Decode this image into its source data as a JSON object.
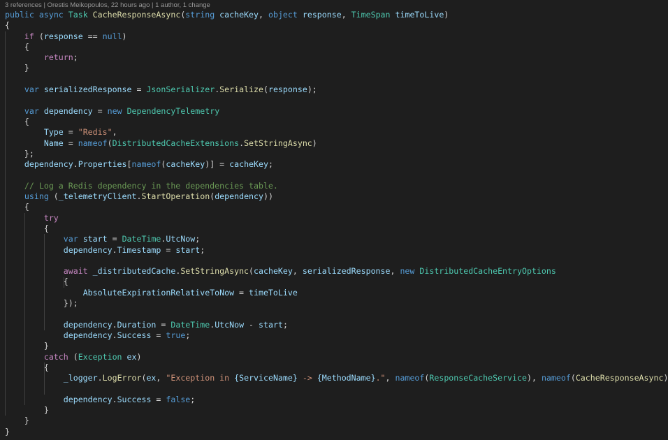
{
  "codelens": {
    "references": "3 references",
    "author": "Orestis Meikopoulos, 22 hours ago",
    "changes": "1 author, 1 change",
    "separator": " | "
  },
  "theme": {
    "background": "#1e1e1e",
    "keyword": "#569cd6",
    "control": "#c586c0",
    "type": "#4ec9b0",
    "method": "#dcdcaa",
    "identifier": "#9cdcfe",
    "string": "#ce9178",
    "comment": "#6a9955",
    "text": "#d4d4d4"
  },
  "code_lines": [
    {
      "spans": [
        {
          "c": "kw",
          "t": "public"
        },
        {
          "c": "tx",
          "t": " "
        },
        {
          "c": "kw",
          "t": "async"
        },
        {
          "c": "tx",
          "t": " "
        },
        {
          "c": "ty",
          "t": "Task"
        },
        {
          "c": "tx",
          "t": " "
        },
        {
          "c": "fn",
          "t": "CacheResponseAsync"
        },
        {
          "c": "tx",
          "t": "("
        },
        {
          "c": "kw",
          "t": "string"
        },
        {
          "c": "tx",
          "t": " "
        },
        {
          "c": "id",
          "t": "cacheKey"
        },
        {
          "c": "tx",
          "t": ", "
        },
        {
          "c": "kw",
          "t": "object"
        },
        {
          "c": "tx",
          "t": " "
        },
        {
          "c": "id",
          "t": "response"
        },
        {
          "c": "tx",
          "t": ", "
        },
        {
          "c": "ty",
          "t": "TimeSpan"
        },
        {
          "c": "tx",
          "t": " "
        },
        {
          "c": "id",
          "t": "timeToLive"
        },
        {
          "c": "tx",
          "t": ")"
        }
      ]
    },
    {
      "spans": [
        {
          "c": "tx",
          "t": "{"
        }
      ]
    },
    {
      "spans": [
        {
          "c": "tx",
          "t": "    "
        },
        {
          "c": "ctl",
          "t": "if"
        },
        {
          "c": "tx",
          "t": " ("
        },
        {
          "c": "id",
          "t": "response"
        },
        {
          "c": "tx",
          "t": " == "
        },
        {
          "c": "kw",
          "t": "null"
        },
        {
          "c": "tx",
          "t": ")"
        }
      ]
    },
    {
      "spans": [
        {
          "c": "tx",
          "t": "    {"
        }
      ]
    },
    {
      "spans": [
        {
          "c": "tx",
          "t": "        "
        },
        {
          "c": "ctl",
          "t": "return"
        },
        {
          "c": "tx",
          "t": ";"
        }
      ]
    },
    {
      "spans": [
        {
          "c": "tx",
          "t": "    }"
        }
      ]
    },
    {
      "spans": []
    },
    {
      "spans": [
        {
          "c": "tx",
          "t": "    "
        },
        {
          "c": "kw",
          "t": "var"
        },
        {
          "c": "tx",
          "t": " "
        },
        {
          "c": "id",
          "t": "serializedResponse"
        },
        {
          "c": "tx",
          "t": " = "
        },
        {
          "c": "ty",
          "t": "JsonSerializer"
        },
        {
          "c": "tx",
          "t": "."
        },
        {
          "c": "fn",
          "t": "Serialize"
        },
        {
          "c": "tx",
          "t": "("
        },
        {
          "c": "id",
          "t": "response"
        },
        {
          "c": "tx",
          "t": ");"
        }
      ]
    },
    {
      "spans": []
    },
    {
      "spans": [
        {
          "c": "tx",
          "t": "    "
        },
        {
          "c": "kw",
          "t": "var"
        },
        {
          "c": "tx",
          "t": " "
        },
        {
          "c": "id",
          "t": "dependency"
        },
        {
          "c": "tx",
          "t": " = "
        },
        {
          "c": "kw",
          "t": "new"
        },
        {
          "c": "tx",
          "t": " "
        },
        {
          "c": "ty",
          "t": "DependencyTelemetry"
        }
      ]
    },
    {
      "spans": [
        {
          "c": "tx",
          "t": "    {"
        }
      ]
    },
    {
      "spans": [
        {
          "c": "tx",
          "t": "        "
        },
        {
          "c": "id",
          "t": "Type"
        },
        {
          "c": "tx",
          "t": " = "
        },
        {
          "c": "str",
          "t": "\"Redis\""
        },
        {
          "c": "tx",
          "t": ","
        }
      ]
    },
    {
      "spans": [
        {
          "c": "tx",
          "t": "        "
        },
        {
          "c": "id",
          "t": "Name"
        },
        {
          "c": "tx",
          "t": " = "
        },
        {
          "c": "kw",
          "t": "nameof"
        },
        {
          "c": "tx",
          "t": "("
        },
        {
          "c": "ty",
          "t": "DistributedCacheExtensions"
        },
        {
          "c": "tx",
          "t": "."
        },
        {
          "c": "fn",
          "t": "SetStringAsync"
        },
        {
          "c": "tx",
          "t": ")"
        }
      ]
    },
    {
      "spans": [
        {
          "c": "tx",
          "t": "    };"
        }
      ]
    },
    {
      "spans": [
        {
          "c": "tx",
          "t": "    "
        },
        {
          "c": "id",
          "t": "dependency"
        },
        {
          "c": "tx",
          "t": "."
        },
        {
          "c": "id",
          "t": "Properties"
        },
        {
          "c": "tx",
          "t": "["
        },
        {
          "c": "kw",
          "t": "nameof"
        },
        {
          "c": "tx",
          "t": "("
        },
        {
          "c": "id",
          "t": "cacheKey"
        },
        {
          "c": "tx",
          "t": ")] = "
        },
        {
          "c": "id",
          "t": "cacheKey"
        },
        {
          "c": "tx",
          "t": ";"
        }
      ]
    },
    {
      "spans": []
    },
    {
      "spans": [
        {
          "c": "tx",
          "t": "    "
        },
        {
          "c": "cmt",
          "t": "// Log a Redis dependency in the dependencies table."
        }
      ]
    },
    {
      "spans": [
        {
          "c": "tx",
          "t": "    "
        },
        {
          "c": "kw",
          "t": "using"
        },
        {
          "c": "tx",
          "t": " ("
        },
        {
          "c": "id",
          "t": "_telemetryClient"
        },
        {
          "c": "tx",
          "t": "."
        },
        {
          "c": "fn",
          "t": "StartOperation"
        },
        {
          "c": "tx",
          "t": "("
        },
        {
          "c": "id",
          "t": "dependency"
        },
        {
          "c": "tx",
          "t": "))"
        }
      ]
    },
    {
      "spans": [
        {
          "c": "tx",
          "t": "    {"
        }
      ]
    },
    {
      "spans": [
        {
          "c": "tx",
          "t": "        "
        },
        {
          "c": "ctl",
          "t": "try"
        }
      ]
    },
    {
      "spans": [
        {
          "c": "tx",
          "t": "        {"
        }
      ]
    },
    {
      "spans": [
        {
          "c": "tx",
          "t": "            "
        },
        {
          "c": "kw",
          "t": "var"
        },
        {
          "c": "tx",
          "t": " "
        },
        {
          "c": "id",
          "t": "start"
        },
        {
          "c": "tx",
          "t": " = "
        },
        {
          "c": "ty",
          "t": "DateTime"
        },
        {
          "c": "tx",
          "t": "."
        },
        {
          "c": "id",
          "t": "UtcNow"
        },
        {
          "c": "tx",
          "t": ";"
        }
      ]
    },
    {
      "spans": [
        {
          "c": "tx",
          "t": "            "
        },
        {
          "c": "id",
          "t": "dependency"
        },
        {
          "c": "tx",
          "t": "."
        },
        {
          "c": "id",
          "t": "Timestamp"
        },
        {
          "c": "tx",
          "t": " = "
        },
        {
          "c": "id",
          "t": "start"
        },
        {
          "c": "tx",
          "t": ";"
        }
      ]
    },
    {
      "spans": []
    },
    {
      "spans": [
        {
          "c": "tx",
          "t": "            "
        },
        {
          "c": "ctl",
          "t": "await"
        },
        {
          "c": "tx",
          "t": " "
        },
        {
          "c": "id",
          "t": "_distributedCache"
        },
        {
          "c": "tx",
          "t": "."
        },
        {
          "c": "fn",
          "t": "SetStringAsync"
        },
        {
          "c": "tx",
          "t": "("
        },
        {
          "c": "id",
          "t": "cacheKey"
        },
        {
          "c": "tx",
          "t": ", "
        },
        {
          "c": "id",
          "t": "serializedResponse"
        },
        {
          "c": "tx",
          "t": ", "
        },
        {
          "c": "kw",
          "t": "new"
        },
        {
          "c": "tx",
          "t": " "
        },
        {
          "c": "ty",
          "t": "DistributedCacheEntryOptions"
        }
      ]
    },
    {
      "spans": [
        {
          "c": "tx",
          "t": "            {"
        }
      ]
    },
    {
      "spans": [
        {
          "c": "tx",
          "t": "                "
        },
        {
          "c": "id",
          "t": "AbsoluteExpirationRelativeToNow"
        },
        {
          "c": "tx",
          "t": " = "
        },
        {
          "c": "id",
          "t": "timeToLive"
        }
      ]
    },
    {
      "spans": [
        {
          "c": "tx",
          "t": "            });"
        }
      ]
    },
    {
      "spans": []
    },
    {
      "spans": [
        {
          "c": "tx",
          "t": "            "
        },
        {
          "c": "id",
          "t": "dependency"
        },
        {
          "c": "tx",
          "t": "."
        },
        {
          "c": "id",
          "t": "Duration"
        },
        {
          "c": "tx",
          "t": " = "
        },
        {
          "c": "ty",
          "t": "DateTime"
        },
        {
          "c": "tx",
          "t": "."
        },
        {
          "c": "id",
          "t": "UtcNow"
        },
        {
          "c": "tx",
          "t": " - "
        },
        {
          "c": "id",
          "t": "start"
        },
        {
          "c": "tx",
          "t": ";"
        }
      ]
    },
    {
      "spans": [
        {
          "c": "tx",
          "t": "            "
        },
        {
          "c": "id",
          "t": "dependency"
        },
        {
          "c": "tx",
          "t": "."
        },
        {
          "c": "id",
          "t": "Success"
        },
        {
          "c": "tx",
          "t": " = "
        },
        {
          "c": "kw",
          "t": "true"
        },
        {
          "c": "tx",
          "t": ";"
        }
      ]
    },
    {
      "spans": [
        {
          "c": "tx",
          "t": "        }"
        }
      ]
    },
    {
      "spans": [
        {
          "c": "tx",
          "t": "        "
        },
        {
          "c": "ctl",
          "t": "catch"
        },
        {
          "c": "tx",
          "t": " ("
        },
        {
          "c": "ty",
          "t": "Exception"
        },
        {
          "c": "tx",
          "t": " "
        },
        {
          "c": "id",
          "t": "ex"
        },
        {
          "c": "tx",
          "t": ")"
        }
      ]
    },
    {
      "spans": [
        {
          "c": "tx",
          "t": "        {"
        }
      ]
    },
    {
      "spans": [
        {
          "c": "tx",
          "t": "            "
        },
        {
          "c": "id",
          "t": "_logger"
        },
        {
          "c": "tx",
          "t": "."
        },
        {
          "c": "fn",
          "t": "LogError"
        },
        {
          "c": "tx",
          "t": "("
        },
        {
          "c": "id",
          "t": "ex"
        },
        {
          "c": "tx",
          "t": ", "
        },
        {
          "c": "str",
          "t": "\"Exception in "
        },
        {
          "c": "ph",
          "t": "{ServiceName}"
        },
        {
          "c": "str",
          "t": " -> "
        },
        {
          "c": "ph",
          "t": "{MethodName}"
        },
        {
          "c": "str",
          "t": ".\""
        },
        {
          "c": "tx",
          "t": ", "
        },
        {
          "c": "kw",
          "t": "nameof"
        },
        {
          "c": "tx",
          "t": "("
        },
        {
          "c": "ty",
          "t": "ResponseCacheService"
        },
        {
          "c": "tx",
          "t": "), "
        },
        {
          "c": "kw",
          "t": "nameof"
        },
        {
          "c": "tx",
          "t": "("
        },
        {
          "c": "fn",
          "t": "CacheResponseAsync"
        },
        {
          "c": "tx",
          "t": "));"
        }
      ]
    },
    {
      "spans": []
    },
    {
      "spans": [
        {
          "c": "tx",
          "t": "            "
        },
        {
          "c": "id",
          "t": "dependency"
        },
        {
          "c": "tx",
          "t": "."
        },
        {
          "c": "id",
          "t": "Success"
        },
        {
          "c": "tx",
          "t": " = "
        },
        {
          "c": "kw",
          "t": "false"
        },
        {
          "c": "tx",
          "t": ";"
        }
      ]
    },
    {
      "spans": [
        {
          "c": "tx",
          "t": "        }"
        }
      ]
    },
    {
      "spans": [
        {
          "c": "tx",
          "t": "    }"
        }
      ]
    },
    {
      "spans": [
        {
          "c": "tx",
          "t": "}"
        }
      ]
    }
  ]
}
